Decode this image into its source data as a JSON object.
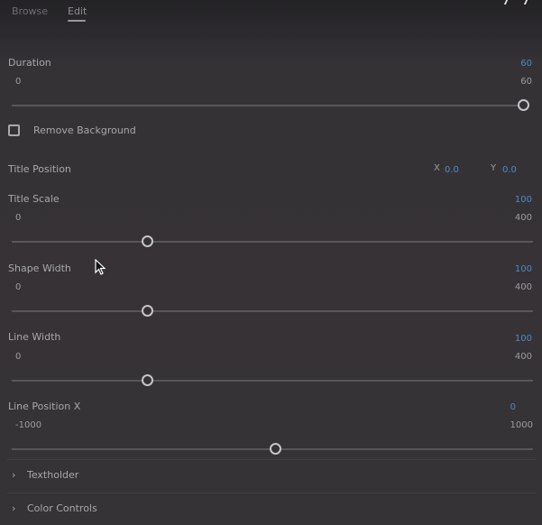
{
  "tabs": [
    {
      "label": "Browse",
      "active": false
    },
    {
      "label": "Edit",
      "active": true
    }
  ],
  "controls": {
    "duration": {
      "label": "Duration",
      "value": "60",
      "min": "0",
      "max": "60",
      "fraction": 1.0
    },
    "remove_background": {
      "label": "Remove Background",
      "checked": false
    },
    "title_position": {
      "label": "Title Position",
      "x_label": "X",
      "x_value": "0.0",
      "y_label": "Y",
      "y_value": "0.0"
    },
    "title_scale": {
      "label": "Title Scale",
      "value": "100",
      "min": "0",
      "max": "400",
      "fraction": 0.25
    },
    "shape_width": {
      "label": "Shape Width",
      "value": "100",
      "min": "0",
      "max": "400",
      "fraction": 0.25
    },
    "line_width": {
      "label": "Line Width",
      "value": "100",
      "min": "0",
      "max": "400",
      "fraction": 0.25
    },
    "line_position_x": {
      "label": "Line Position X",
      "value": "0",
      "min": "-1000",
      "max": "1000",
      "fraction": 0.5
    }
  },
  "sections": [
    {
      "label": "Textholder",
      "icon": "chevron-right-icon",
      "expanded": false
    },
    {
      "label": "Color Controls",
      "icon": "chevron-right-icon",
      "expanded": false
    }
  ],
  "colors": {
    "accent": "#4d8ac4",
    "background": "#363337"
  }
}
